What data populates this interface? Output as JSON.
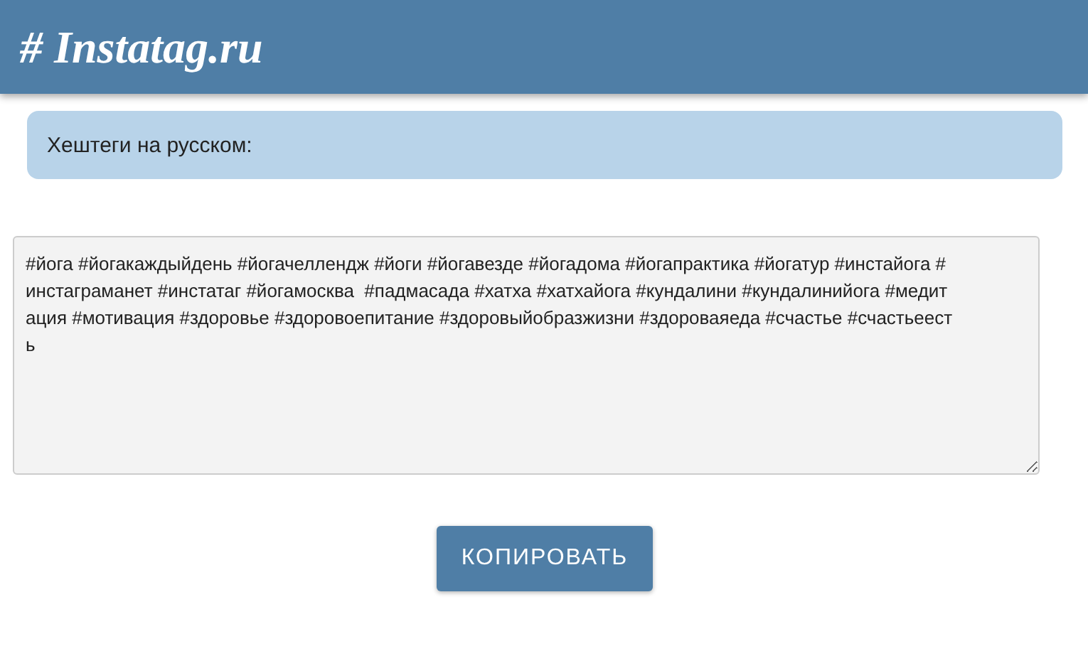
{
  "header": {
    "logo": "# Instatag.ru"
  },
  "section": {
    "title": "Хештеги на русском:"
  },
  "hashtags": {
    "lines": [
      "#йога #йогакаждыйдень #йогачеллендж #йоги #йогавезде #йогадома #йогапрактика #йогатур #инстайога #",
      "инстаграманет #инстатаг #йогамосква  #падмасада #хатха #хатхайога #кундалини #кундалинийога #медит",
      "ация #мотивация #здоровье #здоровоепитание #здоровыйобразжизни #здороваяеда #счастье #счастьеест",
      "ь"
    ]
  },
  "button": {
    "label": "КОПИРОВАТЬ"
  }
}
